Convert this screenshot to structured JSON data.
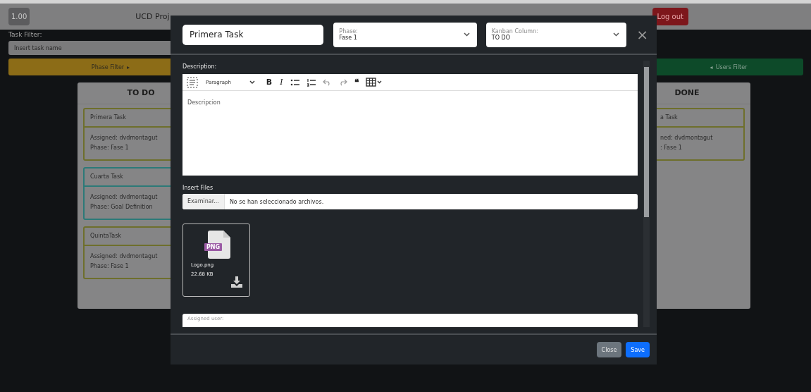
{
  "navbar": {
    "version_badge": "1.00",
    "title": "UCD Proj",
    "logout_button": "Log out"
  },
  "task_filter": {
    "label": "Task Filter:",
    "placeholder": "Insert task name"
  },
  "filter_bars": [
    {
      "kind": "phase",
      "label": "Phase Filter",
      "arrow": "▸"
    },
    {
      "kind": "users",
      "label": "Users Filter",
      "arrow": "◂"
    }
  ],
  "columns": [
    {
      "title": "TO DO",
      "cards": [
        {
          "title": "Primera Task",
          "assigned": "Assigned: dvdmontagut",
          "phase": "Phase: Fase 1",
          "color": "#6e6f2c"
        },
        {
          "title": "Cuarta Task",
          "assigned": "Assigned: dvdmontagut",
          "phase": "Phase: Goal Definition",
          "color": "#2c7a78"
        },
        {
          "title": "QuintaTask",
          "assigned": "Assigned: dvdmontagut",
          "phase": "Phase: Fase 1",
          "color": "#6e6f2c"
        }
      ]
    },
    {
      "title": "DONE",
      "cards": [
        {
          "title": "a Task",
          "assigned": "ned: dvdmontagut",
          "phase": ": Fase 1",
          "color": "#6e6f2c"
        }
      ]
    }
  ],
  "modal": {
    "task_name": "Primera Task",
    "phase_select": {
      "label": "Phase:",
      "value": "Fase 1"
    },
    "column_select": {
      "label": "Kanban Column:",
      "value": "TO DO"
    },
    "close_icon": "×",
    "description_label": "Description:",
    "editor": {
      "format": "Paragraph",
      "content": "Descripcion",
      "tools": [
        {
          "kind": "bold",
          "glyph": "B"
        },
        {
          "kind": "italic",
          "glyph": "I"
        },
        {
          "kind": "bullets"
        },
        {
          "kind": "numbers"
        },
        {
          "kind": "undo"
        },
        {
          "kind": "redo"
        },
        {
          "kind": "quote",
          "glyph": "❝"
        },
        {
          "kind": "table"
        }
      ]
    },
    "files_label": "Insert Files",
    "file_input": {
      "button": "Examinar...",
      "status": "No se han seleccionado archivos."
    },
    "files": [
      {
        "type_label": "PNG",
        "name": "Logo.png",
        "size": "22.68 KB"
      }
    ],
    "assigned_user": {
      "label": "Assigned user:"
    },
    "buttons": [
      {
        "kind": "secondary",
        "label": "Close"
      },
      {
        "kind": "primary",
        "label": "Save"
      }
    ]
  }
}
